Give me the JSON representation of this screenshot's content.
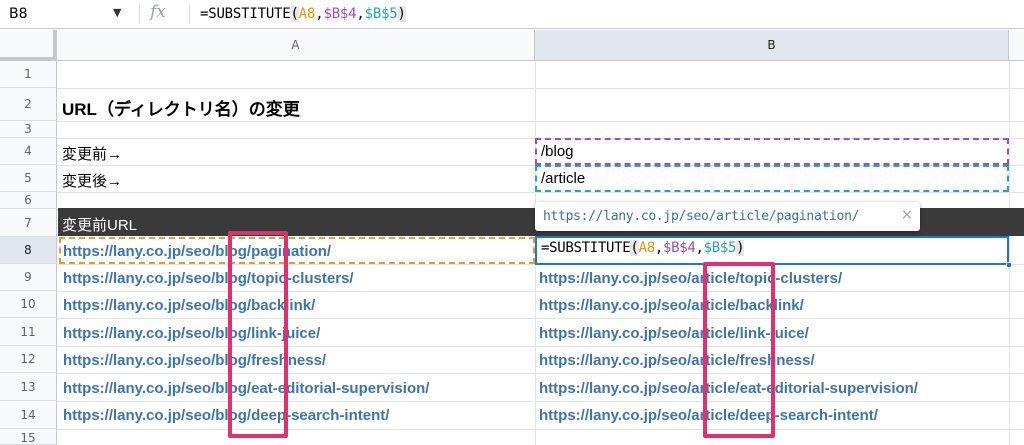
{
  "formula_bar": {
    "cell_ref": "B8",
    "fx": "fx",
    "formula": {
      "prefix": "=SUBSTITUTE",
      "open": "(",
      "arg1": "A8",
      "comma1": ",",
      "arg2": "$B$4",
      "comma2": ",",
      "arg3": "$B$5",
      "close": ")"
    }
  },
  "columns": [
    "A",
    "B"
  ],
  "rows": [
    "1",
    "2",
    "3",
    "4",
    "5",
    "6",
    "7",
    "8",
    "9",
    "10",
    "11",
    "12",
    "13",
    "14",
    "15"
  ],
  "title": "URL（ディレクトリ名）の変更",
  "labels": {
    "before": "変更前→",
    "after": "変更後→",
    "header": "変更前URL"
  },
  "values": {
    "before": "/blog",
    "after": "/article"
  },
  "urls_a": [
    "https://lany.co.jp/seo/blog/pagination/",
    "https://lany.co.jp/seo/blog/topic-clusters/",
    "https://lany.co.jp/seo/blog/backlink/",
    "https://lany.co.jp/seo/blog/link-juice/",
    "https://lany.co.jp/seo/blog/freshness/",
    "https://lany.co.jp/seo/blog/eat-editorial-supervision/",
    "https://lany.co.jp/seo/blog/deep-search-intent/"
  ],
  "urls_b": [
    "https://lany.co.jp/seo/article/topic-clusters/",
    "https://lany.co.jp/seo/article/backlink/",
    "https://lany.co.jp/seo/article/link-juice/",
    "https://lany.co.jp/seo/article/freshness/",
    "https://lany.co.jp/seo/article/eat-editorial-supervision/",
    "https://lany.co.jp/seo/article/deep-search-intent/"
  ],
  "tooltip": {
    "text": "https://lany.co.jp/seo/article/pagination/",
    "close": "×"
  },
  "colors": {
    "accent": "#1a73e8",
    "url_text": "#3d74ad",
    "highlight": "#e0306f",
    "ref_a8": "#e8940a",
    "ref_b4": "#a04fb4",
    "ref_b5": "#22a6b8"
  }
}
